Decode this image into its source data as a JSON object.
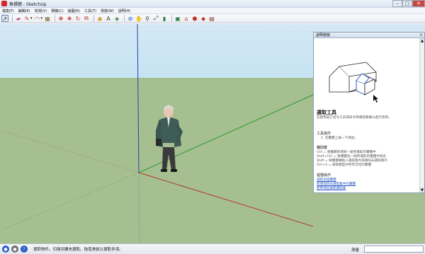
{
  "window": {
    "title": "無標題 - SketchUp",
    "minimize_glyph": "–",
    "maximize_glyph": "□",
    "close_glyph": "✕"
  },
  "menubar": {
    "items": [
      "檔案(F)",
      "編輯(E)",
      "檢視(V)",
      "相機(C)",
      "繪圖(R)",
      "工具(T)",
      "視窗(W)",
      "說明(H)"
    ]
  },
  "toolbar": {
    "tools": [
      {
        "icon": "select-arrow-icon",
        "glyph": "➚",
        "color": "#222222"
      },
      {
        "icon": "eraser-icon",
        "glyph": "▰",
        "color": "#d04a8a"
      },
      {
        "icon": "pencil-icon",
        "glyph": "✎",
        "color": "#c0392b"
      },
      {
        "icon": "arc-icon",
        "glyph": "◠",
        "color": "#c0392b"
      },
      {
        "icon": "rectangle-icon",
        "glyph": "▦",
        "color": "#8a6d3b"
      },
      {
        "icon": "move-icon",
        "glyph": "✥",
        "color": "#c0392b"
      },
      {
        "icon": "push-pull-icon",
        "glyph": "❖",
        "color": "#c0392b"
      },
      {
        "icon": "rotate-icon",
        "glyph": "↻",
        "color": "#c0392b"
      },
      {
        "icon": "offset-icon",
        "glyph": "⧉",
        "color": "#c0392b"
      },
      {
        "icon": "tape-measure-icon",
        "glyph": "◉",
        "color": "#c49a1b"
      },
      {
        "icon": "text-icon",
        "glyph": "A",
        "color": "#444444"
      },
      {
        "icon": "paint-bucket-icon",
        "glyph": "◈",
        "color": "#2f7a3a"
      },
      {
        "icon": "orbit-icon",
        "glyph": "⊛",
        "color": "#2a5bc5"
      },
      {
        "icon": "pan-icon",
        "glyph": "✋",
        "color": "#6b4a2b"
      },
      {
        "icon": "zoom-icon",
        "glyph": "⚲",
        "color": "#333333"
      },
      {
        "icon": "zoom-extents-icon",
        "glyph": "⤢",
        "color": "#333333"
      },
      {
        "icon": "model-info-icon",
        "glyph": "▮",
        "color": "#2f7a3a"
      },
      {
        "icon": "components-icon",
        "glyph": "▣",
        "color": "#2f7a3a"
      },
      {
        "icon": "warehouse-icon",
        "glyph": "⌂",
        "color": "#c0392b"
      },
      {
        "icon": "share-component-icon",
        "glyph": "⬢",
        "color": "#c0392b"
      },
      {
        "icon": "extension-icon",
        "glyph": "◆",
        "color": "#c0392b"
      },
      {
        "icon": "layout-icon",
        "glyph": "▤",
        "color": "#8a3b2b"
      }
    ]
  },
  "instructor": {
    "title": "說明視窗",
    "close_glyph": "×",
    "tool_name": "選取工具",
    "tool_desc": "在使用其它指令工具或命令時選取要繪以進行修改。",
    "operation_head": "工具操作",
    "operation_steps": [
      "1. 在實體上按一下滑鼠。"
    ],
    "modifier_head": "輔助鍵",
    "modifiers": [
      "Ctrl = 將實體新增到一組所選取的實體中",
      "Shift+Ctrl = 將實體從一組所選取的實體中除去",
      "Shift = 將實體轉換入選取集內或將除去選取集外",
      "Ctrl+A = 選取模型中所有可見的實體"
    ],
    "advanced_head": "進階操作",
    "advanced_links": [
      "選取多個實體",
      "新增或除去選取集中的實體",
      "使用滑鼠展開選取集"
    ]
  },
  "status": {
    "hint": "選取物件。切換到擴充選取。拖曳滑鼠以選取多項。",
    "measure_label": "測量",
    "measure_value": ""
  },
  "colors": {
    "sky": "#c6e3f3",
    "ground": "#a5bf90",
    "axis_blue": "#2b3fb0",
    "axis_green": "#2f9a2f",
    "axis_red": "#b03a2b"
  }
}
